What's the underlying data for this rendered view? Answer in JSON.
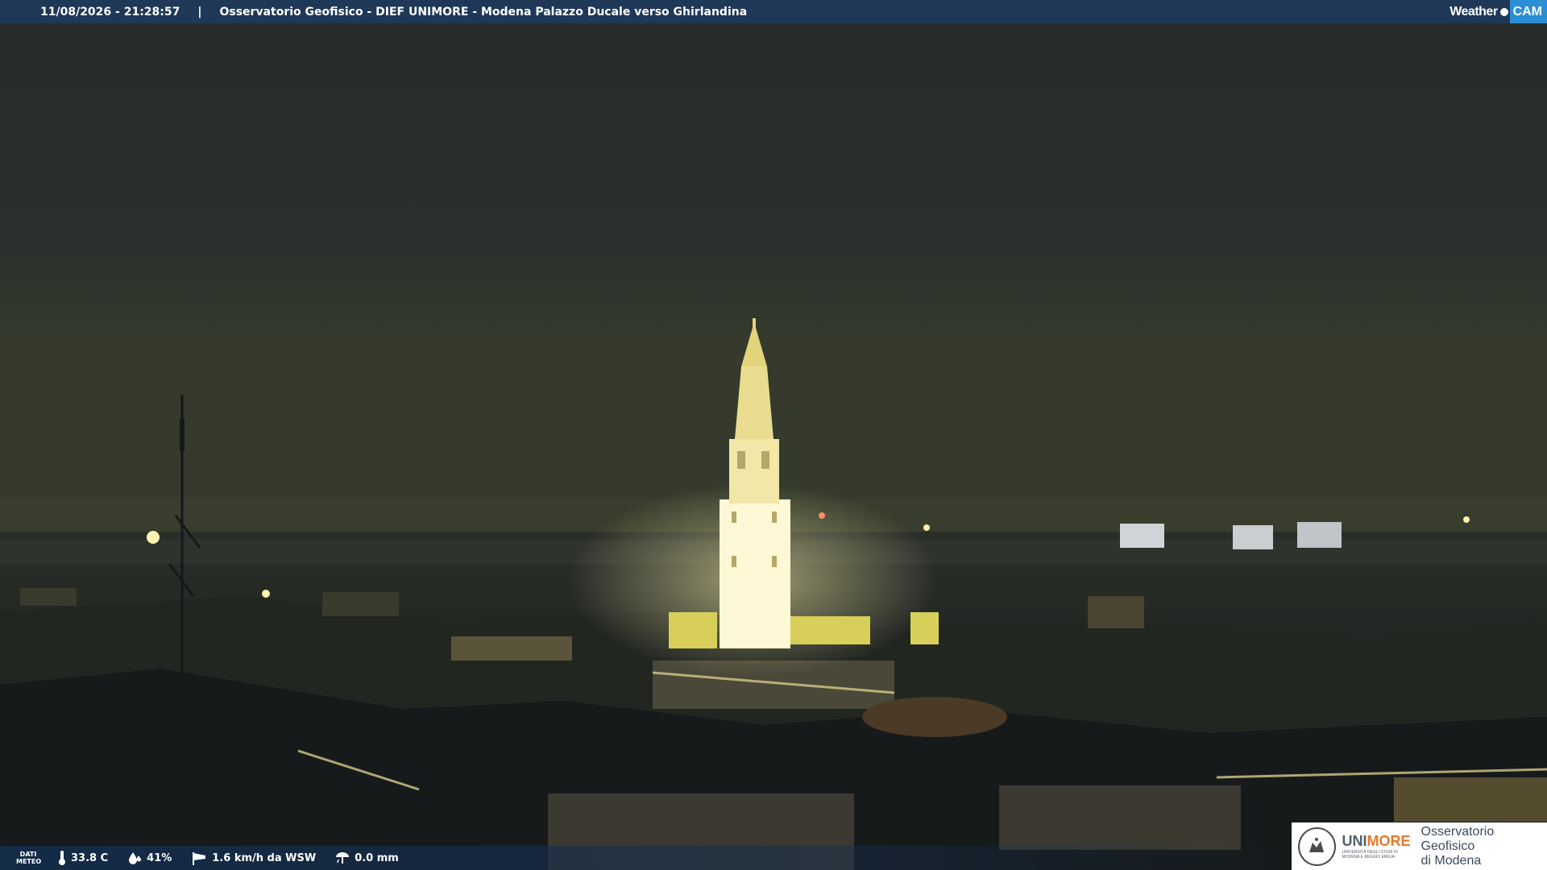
{
  "header": {
    "timestamp": "11/08/2026 - 21:28:57",
    "separator": "|",
    "title": "Osservatorio Geofisico - DIEF UNIMORE - Modena Palazzo Ducale verso Ghirlandina",
    "brand_weather": "Weather",
    "brand_cam": "CAM"
  },
  "meteo": {
    "label_line1": "DATI",
    "label_line2": "METEO",
    "temperature": "33.8 C",
    "humidity": "41%",
    "wind": "1.6 km/h da WSW",
    "rain": "0.0 mm"
  },
  "logo": {
    "university": "UNIMORE",
    "university_sub": "UNIVERSITÀ DEGLI STUDI DI MODENA E REGGIO EMILIA",
    "observatory_line1": "Osservatorio Geofisico",
    "observatory_line2": "di Modena"
  },
  "colors": {
    "header_bar": "#1e3a5c",
    "sky": "#2a302c",
    "tower_light": "#fff5c2",
    "brand_blue": "#2b8fd6",
    "unimore_orange": "#e8782a"
  },
  "icons": {
    "temperature": "thermometer-icon",
    "humidity": "droplet-icon",
    "wind": "windsock-icon",
    "rain": "rain-gauge-icon"
  }
}
